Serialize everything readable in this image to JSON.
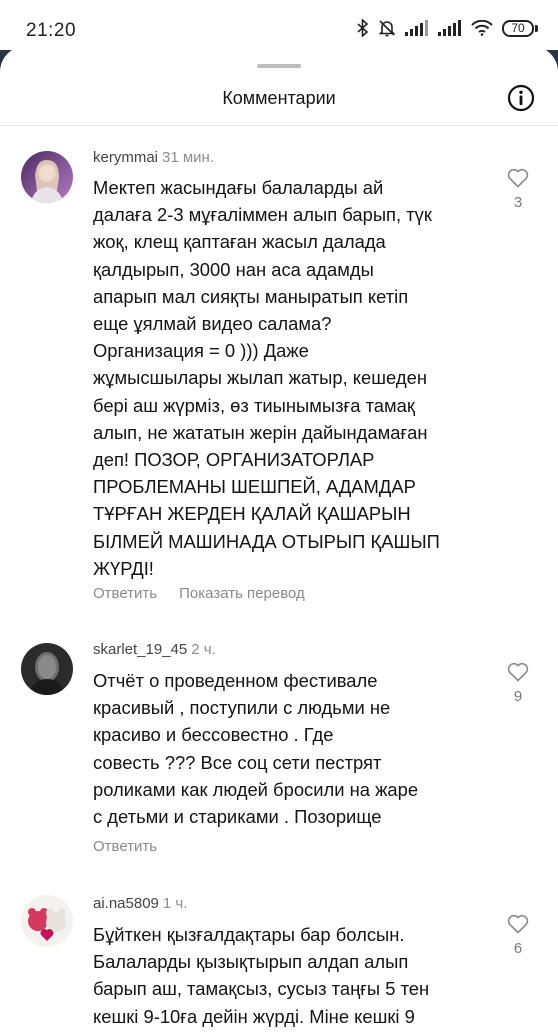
{
  "status_bar": {
    "time": "21:20",
    "battery": "70"
  },
  "sheet": {
    "title": "Комментарии"
  },
  "comments": [
    {
      "username": "kerymmai",
      "time": "31 мин.",
      "text": "Мектеп жасындағы  балаларды ай\nдалаға 2-3 мұғаліммен алып барып, түк\nжоқ, клещ қаптаған жасыл далада\nқалдырып, 3000 нан аса адамды\nапарып мал сияқты маныратып кетіп\nеще ұялмай видео салама?\nОрганизация = 0 ))) Даже\nжұмысшылары жылап жатыр, кешеден\nбері аш жүрміз, өз тиынымызға тамақ\nалып, не жататын жерін дайындамаған\nдеп! ПОЗОР, ОРГАНИЗАТОРЛАР\nПРОБЛЕМАНЫ ШЕШПЕЙ, АДАМДАР\nТҰРҒАН ЖЕРДЕН ҚАЛАЙ ҚАШАРЫН\nБІЛМЕЙ МАШИНАДА ОТЫРЫП ҚАШЫП\nЖҮРДІ!",
      "reply_label": "Ответить",
      "translate_label": "Показать перевод",
      "likes": "3"
    },
    {
      "username": "skarlet_19_45",
      "time": "2 ч.",
      "text": "Отчёт  о проведенном фестивале\nкрасивый , поступили с людьми не\nкрасиво и бессовестно .  Где\nсовесть ??? Все соц сети пестрят\nроликами как людей бросили на жаре\nс детьми и стариками . Позорище",
      "reply_label": "Ответить",
      "likes": "9"
    },
    {
      "username": "ai.na5809",
      "time": "1 ч.",
      "text": "Бұйткен қызғалдақтары бар болсын.\nБалаларды қызықтырып алдап алып\nбарып аш, тамақсыз, сусыз таңғы 5 тен\nкешкі 9-10ға дейін жүрді. Міне кешкі 9",
      "likes": "6"
    }
  ]
}
